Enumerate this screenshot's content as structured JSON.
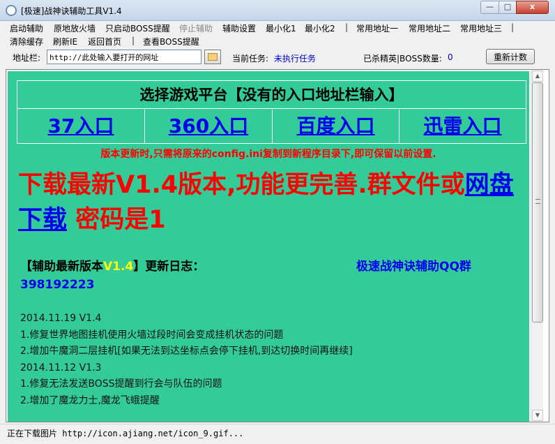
{
  "window": {
    "title": "[极速]战神诀辅助工具V1.4",
    "minimize_glyph": "—",
    "maximize_glyph": "□",
    "close_glyph": "x"
  },
  "menu": {
    "row1": [
      "启动辅助",
      "原地放火墙",
      "只启动BOSS提醒",
      "停止辅助",
      "辅助设置",
      "最小化1",
      "最小化2",
      "|",
      "常用地址一",
      "常用地址二",
      "常用地址三",
      "|"
    ],
    "row2": [
      "清除缓存",
      "刷新IE",
      "返回首页",
      "|",
      "查看BOSS提醒"
    ]
  },
  "address_bar": {
    "label": "地址栏:",
    "value": "http://此处输入要打开的网址",
    "task_label": "当前任务:",
    "task_value": "未执行任务",
    "kill_label": "已杀精英|BOSS数量:",
    "kill_value": "0",
    "reset_label": "重新计数"
  },
  "page": {
    "platform_title": "选择游戏平台【没有的入口地址栏输入】",
    "platforms": [
      "37入口",
      "360入口",
      "百度入口",
      "迅雷入口"
    ],
    "notice": "版本更新时,只需将原来的config.ini复制到新程序目录下,即可保留以前设置.",
    "headline_part1": "下载最新V1.4版本,功能更完善.群文件或",
    "headline_link": "网盘下载",
    "headline_part2": " 密码是1",
    "version_prefix": "【辅助最新版本",
    "version": "V1.4",
    "version_suffix": "】更新日志：",
    "qq_label": "极速战神诀辅助QQ群",
    "qq_number": "398192223",
    "changelog": [
      "2014.11.19 V1.4",
      "1.修复世界地图挂机使用火墙过段时间会变成挂机状态的问题",
      "2.增加牛魔洞二层挂机[如果无法到达坐标点会停下挂机,到达切换时间再继续]",
      "2014.11.12 V1.3",
      "1.修复无法发送BOSS提醒到行会与队伍的问题",
      "2.增加了魔龙力士,魔龙飞蛾提醒"
    ]
  },
  "status": {
    "label": "正在下载图片",
    "url": "http://icon.ajiang.net/icon_9.gif..."
  }
}
